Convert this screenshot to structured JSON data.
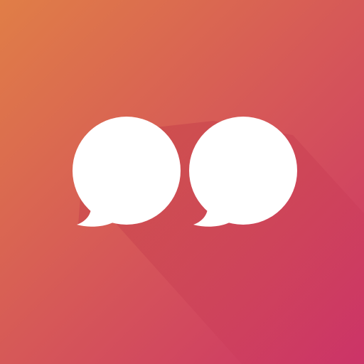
{
  "icon": {
    "name": "chat-bubbles-icon",
    "colors": {
      "gradient_start": "#e07e47",
      "gradient_end": "#cc3368",
      "bubble_fill": "#ffffff",
      "shadow": "#b4203f"
    }
  }
}
